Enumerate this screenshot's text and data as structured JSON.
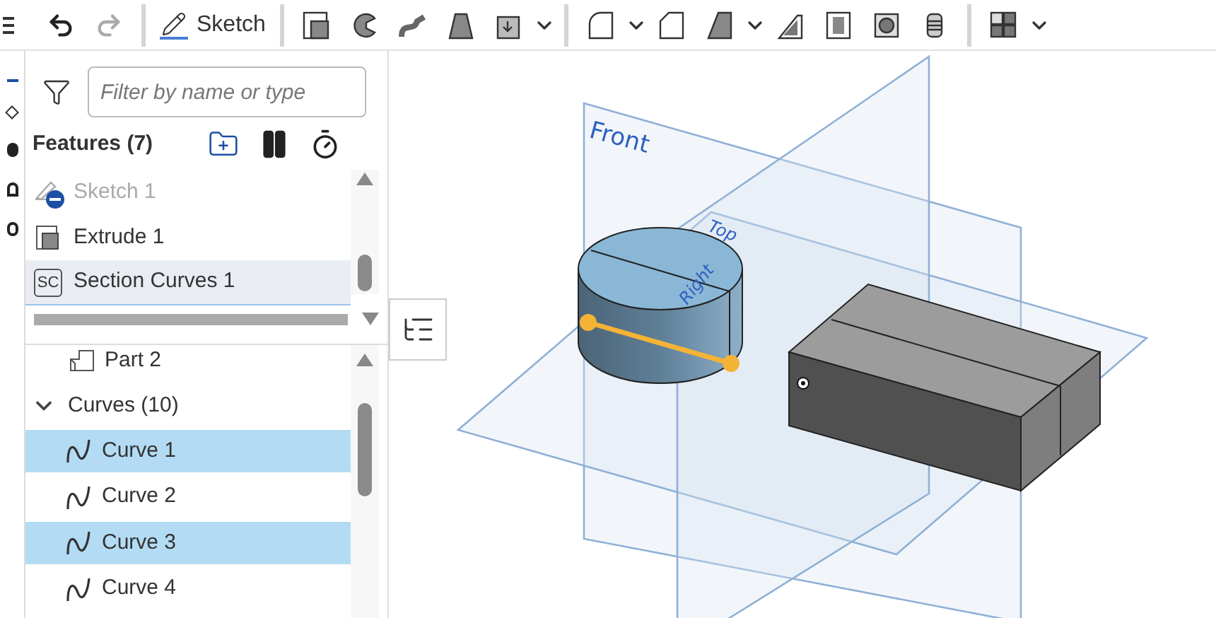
{
  "toolbar": {
    "sketch_label": "Sketch"
  },
  "feature_panel": {
    "filter": {
      "placeholder": "Filter by name or type"
    },
    "header": "Features (7)",
    "features": [
      {
        "kind": "sketch",
        "label": "Sketch 1",
        "suppressed": true,
        "selected": false
      },
      {
        "kind": "extrude",
        "label": "Extrude 1",
        "suppressed": false,
        "selected": false
      },
      {
        "kind": "section",
        "badge": "SC",
        "label": "Section Curves 1",
        "suppressed": false,
        "selected": true
      }
    ],
    "parts": [
      {
        "label": "Part 2"
      }
    ],
    "curves": {
      "label": "Curves (10)",
      "expanded": true,
      "items": [
        {
          "label": "Curve 1",
          "selected": true
        },
        {
          "label": "Curve 2",
          "selected": false
        },
        {
          "label": "Curve 3",
          "selected": true
        },
        {
          "label": "Curve 4",
          "selected": false
        }
      ]
    }
  },
  "viewport": {
    "planes": [
      {
        "label": "Front"
      },
      {
        "label": "Top"
      },
      {
        "label": "Right"
      }
    ]
  }
}
